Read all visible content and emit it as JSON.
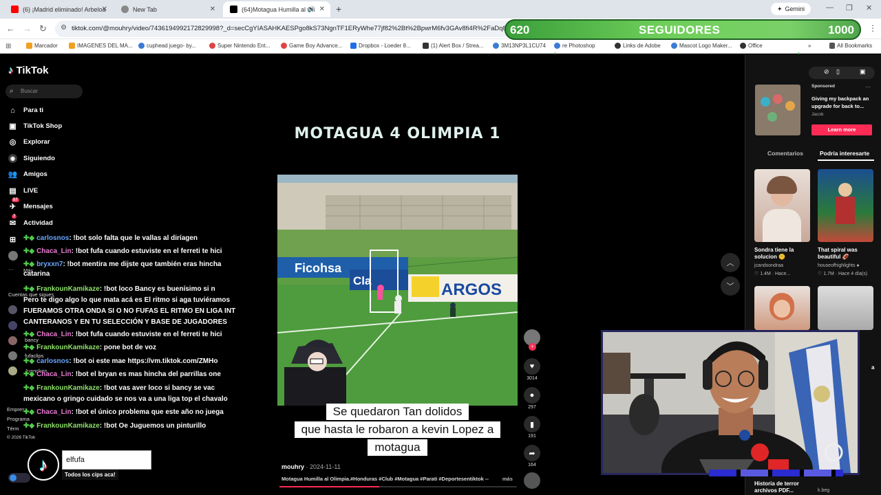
{
  "browser": {
    "tabs": [
      {
        "label": "(6) ¡Madrid eliminado! Arbeloa",
        "icon": "youtube-icon",
        "color": "#ff0000"
      },
      {
        "label": "New Tab",
        "icon": "chrome-icon",
        "color": "#555555"
      },
      {
        "label": "(64)Motagua Humilla al Oli",
        "icon": "tiktok-icon",
        "color": "#000000"
      }
    ],
    "new_tab": "+",
    "gemini": "Gemini",
    "url": "tiktok.com/@mouhry/video/7436194992172829998?_d=secCgYIASAHKAESPgo8kS73NgnTF1ERyWhe77jf82%2Bt%2BpwrM6fv3GAv8fi4R%2FaDq8pJxR%",
    "bookmarks": [
      {
        "label": "Marcador",
        "color": "#f0a020"
      },
      {
        "label": "IMAGENES DEL MA...",
        "color": "#f0a020"
      },
      {
        "label": "cuphead juego- by...",
        "color": "#3b7bd6"
      },
      {
        "label": "Super Nintendo Ent...",
        "color": "#d44"
      },
      {
        "label": "Game Boy Advance...",
        "color": "#d44"
      },
      {
        "label": "Dropbox - Loeder 8...",
        "color": "#1e6ee8"
      },
      {
        "label": "(1) Alert Box / Strea...",
        "color": "#333"
      },
      {
        "label": "3M13NP3L1CU74",
        "color": "#3b7bd6"
      },
      {
        "label": "re Photoshop",
        "color": "#3b7bd6"
      },
      {
        "label": "Links de Adobe",
        "color": "#333"
      },
      {
        "label": "Mascot Logo Maker...",
        "color": "#3b7bd6"
      },
      {
        "label": "Office",
        "color": "#333"
      },
      {
        "label": "All Bookmarks",
        "color": "#555"
      }
    ]
  },
  "overlay": {
    "followers_current": "620",
    "followers_label": "SEGUIDORES",
    "followers_goal": "1000",
    "progress_fraction": 0.62
  },
  "tiktok": {
    "logo": "TikTok",
    "search_placeholder": "Buscar",
    "nav": [
      {
        "label": "Para ti",
        "icon": "home-icon"
      },
      {
        "label": "TikTok Shop",
        "icon": "shop-icon"
      },
      {
        "label": "Explorar",
        "icon": "compass-icon"
      },
      {
        "label": "Siguiendo",
        "icon": "following-icon"
      },
      {
        "label": "Amigos",
        "icon": "friends-icon"
      },
      {
        "label": "LIVE",
        "icon": "live-icon"
      },
      {
        "label": "Mensajes",
        "icon": "messages-icon",
        "badge": "57"
      },
      {
        "label": "Actividad",
        "icon": "activity-icon",
        "badge": "7"
      }
    ],
    "faded": {
      "mas": "Más",
      "cuentas": "Cuentas que sigues",
      "empresa": "Empresa",
      "programa": "Programa",
      "terminos": "Térm",
      "copyright": "© 2026 TikTok",
      "followed": [
        "bancy",
        "fufaclips",
        "Juanchon"
      ]
    }
  },
  "chat": [
    {
      "user": "carlosnos",
      "color": "blue",
      "msg": ": !bot solo falta que le vallas al diríagen"
    },
    {
      "user": "Chaca_Lin",
      "color": "pink",
      "msg": ": !bot fufa cuando estuviste en el ferreti te hici"
    },
    {
      "user": "bryxxn7",
      "color": "blue",
      "msg": ": !bot mentira me dijste que también eras hincha"
    },
    {
      "user": "",
      "color": "",
      "msg": "catarina"
    },
    {
      "user": "FrankounKamikaze",
      "color": "green",
      "msg": ": !bot loco Bancy es buenísimo si n"
    },
    {
      "user": "",
      "color": "",
      "msg": "Pero te digo algo lo que mata acá es El ritmo si aga tuviéramos"
    },
    {
      "user": "",
      "color": "",
      "msg": "FUERAMOS OTRA ONDA SI O NO FUFAS EL RITMO EN LIGA INT"
    },
    {
      "user": "",
      "color": "",
      "msg": "CANTERANOS Y EN TU SELECCIÓN Y BASE DE JUGADORES"
    },
    {
      "user": "Chaca_Lin",
      "color": "pink",
      "msg": ": !bot fufa cuando estuviste en el ferreti te hici"
    },
    {
      "user": "FrankounKamikaze",
      "color": "green",
      "msg": ": pone bot de voz"
    },
    {
      "user": "carlosnos",
      "color": "blue",
      "msg": ": !bot oi este mae https://vm.tiktok.com/ZMHo"
    },
    {
      "user": "Chaca_Lin",
      "color": "pink",
      "msg": ": !bot el bryan es mas hincha del parrillas one"
    },
    {
      "user": "FrankounKamikaze",
      "color": "green",
      "msg": ": !bot vas aver loco si bancy se vac"
    },
    {
      "user": "",
      "color": "",
      "msg": "mexicano o gringo cuidado se nos va a una liga top el chavalo"
    },
    {
      "user": "Chaca_Lin",
      "color": "pink",
      "msg": ": !bot el único problema que este año no juega"
    },
    {
      "user": "FrankounKamikaze",
      "color": "green",
      "msg": ": !bot Oe Juguemos un pinturillo"
    }
  ],
  "video": {
    "headline": "MOTAGUA 4 OLIMPIA 1",
    "caption_lines": [
      "Se quedaron Tan dolidos",
      "que hasta le robaron a kevin Lopez a",
      "motagua"
    ],
    "author": "mouhry",
    "date": "· 2024-11-11",
    "description": "Motagua Humilla al Olimpia.#Honduras #Club #Motagua #Parati #Deportesentiktok --",
    "more": "más",
    "ads": [
      "Ficohsa",
      "Cla",
      "ARGOS"
    ],
    "progress_fraction": 0.42,
    "likes": "3014",
    "comments": "297",
    "saves": "191",
    "shares": "164"
  },
  "right_panel": {
    "sponsored_label": "Sponsored",
    "ad_title": "Giving my backpack an upgrade for back to...",
    "ad_author": "Jacob",
    "learn_more": "Learn more",
    "tab_comments": "Comentarios",
    "tab_interest": "Podría interesarte",
    "cards": [
      {
        "title": "Sondra tiene la solucion 🤫",
        "author": "jcandsondraa",
        "meta": "♡ 1.4M · Hace..."
      },
      {
        "title": "That spiral was beautiful 🏈",
        "author": "houseofhighlights ●",
        "meta": "♡ 1.7M · Hace 4 día(s)"
      },
      {
        "title": "Historia de terror archivos PDF...",
        "author": "",
        "meta": ""
      },
      {
        "title": "",
        "author": "k.beg",
        "meta": ""
      }
    ],
    "partial_card_text": "a"
  },
  "webcam_overlay": {
    "username": "elfufa",
    "tagline": "Todos los cips aca!"
  }
}
